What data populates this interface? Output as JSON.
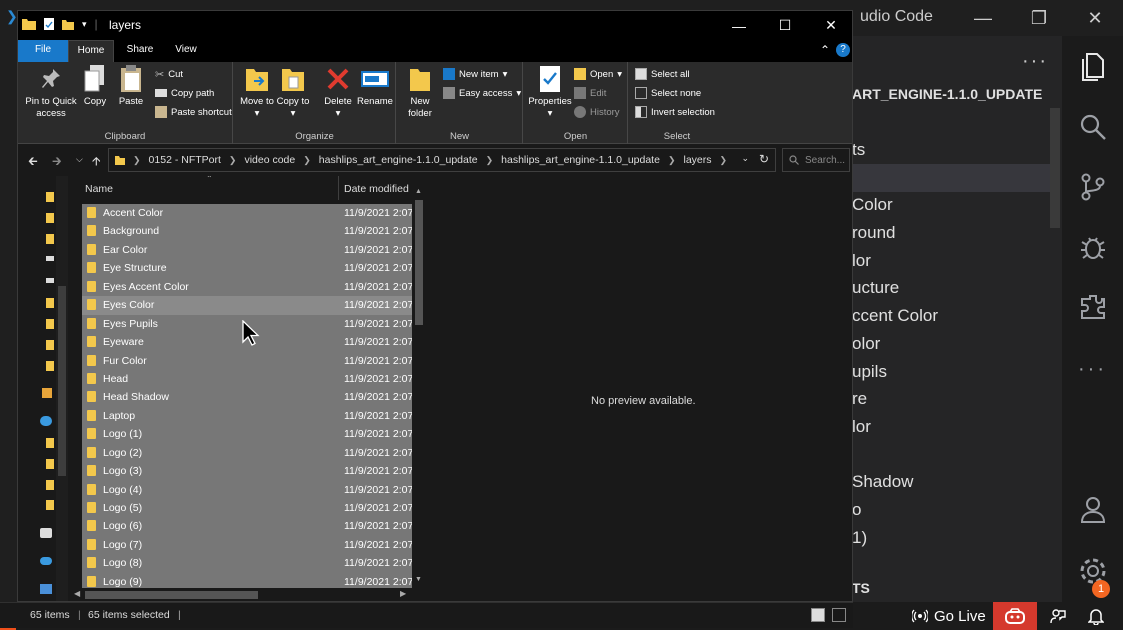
{
  "vscode": {
    "title": "udio Code",
    "explorer_header": "ART_ENGINE-1.1.0_UPDATE",
    "explorer_items": [
      "ts",
      "",
      " Color",
      "round",
      "lor",
      "ucture",
      "ccent Color",
      "olor",
      "upils",
      "re",
      "lor",
      "",
      "Shadow",
      "o",
      "1)"
    ],
    "outline_header": "TS",
    "settings_badge": "1",
    "status": {
      "go_live": "Go Live"
    },
    "icons": [
      "files-icon",
      "search-icon",
      "source-control-icon",
      "debug-icon",
      "extensions-icon",
      "more-icon",
      "account-icon",
      "settings-icon"
    ],
    "accent": "#ef4f1a"
  },
  "explorer": {
    "title": "layers",
    "tabs": {
      "file": "File",
      "home": "Home",
      "share": "Share",
      "view": "View"
    },
    "ribbon": {
      "clipboard": {
        "label": "Clipboard",
        "pin": "Pin to Quick access",
        "copy": "Copy",
        "paste": "Paste",
        "cut": "Cut",
        "copy_path": "Copy path",
        "paste_shortcut": "Paste shortcut"
      },
      "organize": {
        "label": "Organize",
        "move_to": "Move to",
        "copy_to": "Copy to",
        "delete": "Delete",
        "rename": "Rename"
      },
      "new": {
        "label": "New",
        "new_folder": "New folder",
        "new_item": "New item",
        "easy_access": "Easy access"
      },
      "open": {
        "label": "Open",
        "properties": "Properties",
        "open": "Open",
        "edit": "Edit",
        "history": "History"
      },
      "select": {
        "label": "Select",
        "select_all": "Select all",
        "select_none": "Select none",
        "invert": "Invert selection"
      }
    },
    "breadcrumb": [
      "0152 - NFTPort",
      "video code",
      "hashlips_art_engine-1.1.0_update",
      "hashlips_art_engine-1.1.0_update",
      "layers"
    ],
    "search_placeholder": "Search...",
    "columns": {
      "name": "Name",
      "date": "Date modified"
    },
    "files": [
      {
        "name": "Accent Color",
        "date": "11/9/2021 2:07"
      },
      {
        "name": "Background",
        "date": "11/9/2021 2:07"
      },
      {
        "name": "Ear Color",
        "date": "11/9/2021 2:07"
      },
      {
        "name": "Eye Structure",
        "date": "11/9/2021 2:07"
      },
      {
        "name": "Eyes Accent Color",
        "date": "11/9/2021 2:07"
      },
      {
        "name": "Eyes Color",
        "date": "11/9/2021 2:07"
      },
      {
        "name": "Eyes Pupils",
        "date": "11/9/2021 2:07"
      },
      {
        "name": "Eyeware",
        "date": "11/9/2021 2:07"
      },
      {
        "name": "Fur Color",
        "date": "11/9/2021 2:07"
      },
      {
        "name": "Head",
        "date": "11/9/2021 2:07"
      },
      {
        "name": "Head Shadow",
        "date": "11/9/2021 2:07"
      },
      {
        "name": "Laptop",
        "date": "11/9/2021 2:07"
      },
      {
        "name": "Logo (1)",
        "date": "11/9/2021 2:07"
      },
      {
        "name": "Logo (2)",
        "date": "11/9/2021 2:07"
      },
      {
        "name": "Logo (3)",
        "date": "11/9/2021 2:07"
      },
      {
        "name": "Logo (4)",
        "date": "11/9/2021 2:07"
      },
      {
        "name": "Logo (5)",
        "date": "11/9/2021 2:07"
      },
      {
        "name": "Logo (6)",
        "date": "11/9/2021 2:07"
      },
      {
        "name": "Logo (7)",
        "date": "11/9/2021 2:07"
      },
      {
        "name": "Logo (8)",
        "date": "11/9/2021 2:07"
      },
      {
        "name": "Logo (9)",
        "date": "11/9/2021 2:07"
      }
    ],
    "preview_text": "No preview available.",
    "status": {
      "items": "65 items",
      "selected": "65 items selected"
    }
  }
}
